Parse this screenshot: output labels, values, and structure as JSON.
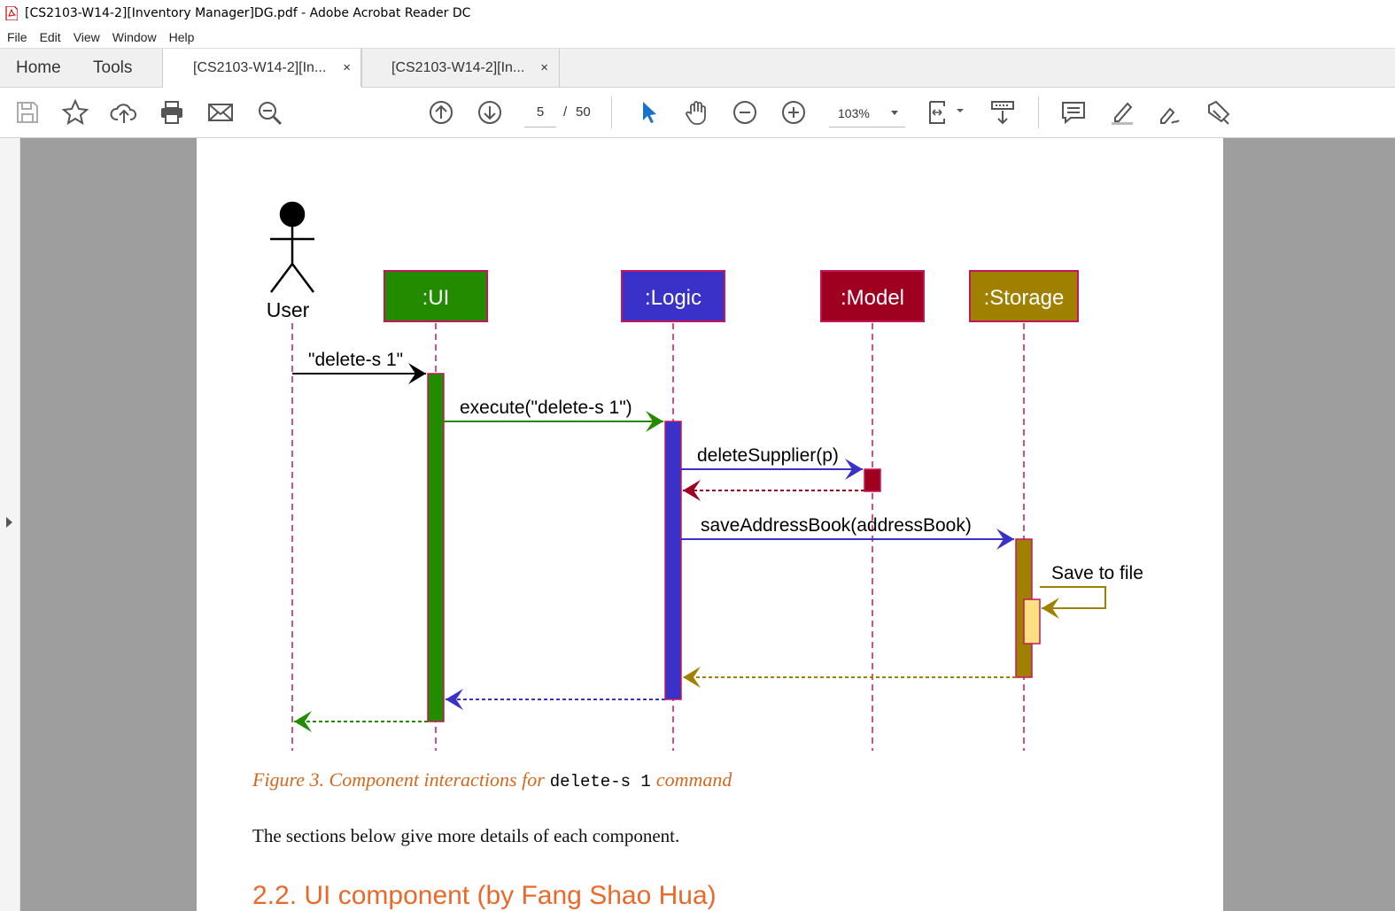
{
  "window": {
    "title": "[CS2103-W14-2][Inventory Manager]DG.pdf - Adobe Acrobat Reader DC"
  },
  "menu": {
    "items": [
      "File",
      "Edit",
      "View",
      "Window",
      "Help"
    ]
  },
  "tabs": {
    "home": "Home",
    "tools": "Tools",
    "documents": [
      {
        "label": "[CS2103-W14-2][In...",
        "close": "×"
      },
      {
        "label": "[CS2103-W14-2][In...",
        "close": "×"
      }
    ]
  },
  "toolbar": {
    "page_current": "5",
    "page_separator": "/",
    "page_total": "50",
    "zoom": "103%",
    "icons": [
      "save-icon",
      "bookmark-star-icon",
      "upload-cloud-icon",
      "print-icon",
      "email-icon",
      "search-zoom-icon",
      "previous-page-icon",
      "next-page-icon",
      "select-cursor-icon",
      "hand-tool-icon",
      "zoom-out-icon",
      "zoom-in-icon",
      "page-fit-icon",
      "scroll-mode-icon",
      "comment-icon",
      "highlight-icon",
      "sign-icon",
      "fill-sign-icon"
    ]
  },
  "diagram": {
    "actor": "User",
    "participants": [
      {
        "label": ":UI",
        "color": "#228b00"
      },
      {
        "label": ":Logic",
        "color": "#3a32c8"
      },
      {
        "label": ":Model",
        "color": "#a00020"
      },
      {
        "label": ":Storage",
        "color": "#a08000"
      }
    ],
    "messages": [
      "\"delete-s 1\"",
      "execute(\"delete-s 1\")",
      "deleteSupplier(p)",
      "saveAddressBook(addressBook)",
      "Save to file"
    ]
  },
  "document": {
    "caption_prefix": "Figure 3. Component interactions for",
    "caption_code": "delete-s 1",
    "caption_suffix": "command",
    "paragraph": "The sections below give more details of each component.",
    "heading": "2.2. UI component (by Fang Shao Hua)"
  },
  "colors": {
    "accent": "#e8692a",
    "caption": "#d2691e"
  }
}
